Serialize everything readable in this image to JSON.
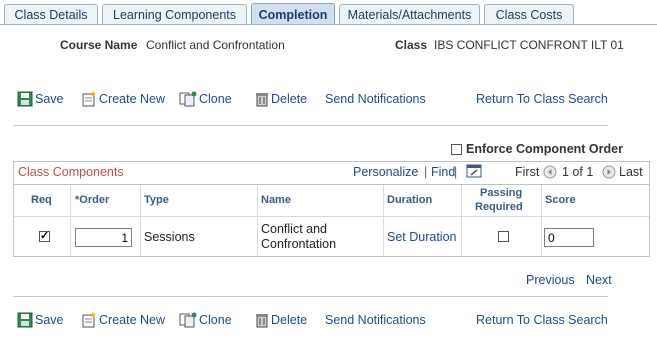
{
  "tabs": [
    {
      "label": "Class Details"
    },
    {
      "label": "Learning Components"
    },
    {
      "label": "Completion"
    },
    {
      "label": "Materials/Attachments"
    },
    {
      "label": "Class Costs"
    }
  ],
  "header": {
    "course_label": "Course Name",
    "course_value": "Conflict and Confrontation",
    "class_label": "Class",
    "class_value": "IBS CONFLICT CONFRONT ILT 01"
  },
  "toolbar": {
    "save": "Save",
    "create_new": "Create New",
    "clone": "Clone",
    "delete": "Delete",
    "send_notifications": "Send Notifications",
    "return": "Return To Class Search"
  },
  "enforce_order": {
    "label": "Enforce Component Order",
    "checked": false
  },
  "grid": {
    "title": "Class Components",
    "personalize": "Personalize",
    "find": "Find",
    "first": "First",
    "count": "1 of 1",
    "last": "Last",
    "columns": {
      "req": "Req",
      "order": "*Order",
      "type": "Type",
      "name": "Name",
      "duration": "Duration",
      "passing_1": "Passing",
      "passing_2": "Required",
      "score": "Score"
    },
    "row": {
      "req_checked": true,
      "order": "1",
      "type": "Sessions",
      "name_1": "Conflict and",
      "name_2": "Confrontation",
      "duration": "Set Duration",
      "passing_checked": false,
      "score": "0"
    }
  },
  "pager": {
    "previous": "Previous",
    "next": "Next"
  },
  "colors": {
    "accent": "#1a4d8c",
    "grid_title": "#c0504d"
  }
}
